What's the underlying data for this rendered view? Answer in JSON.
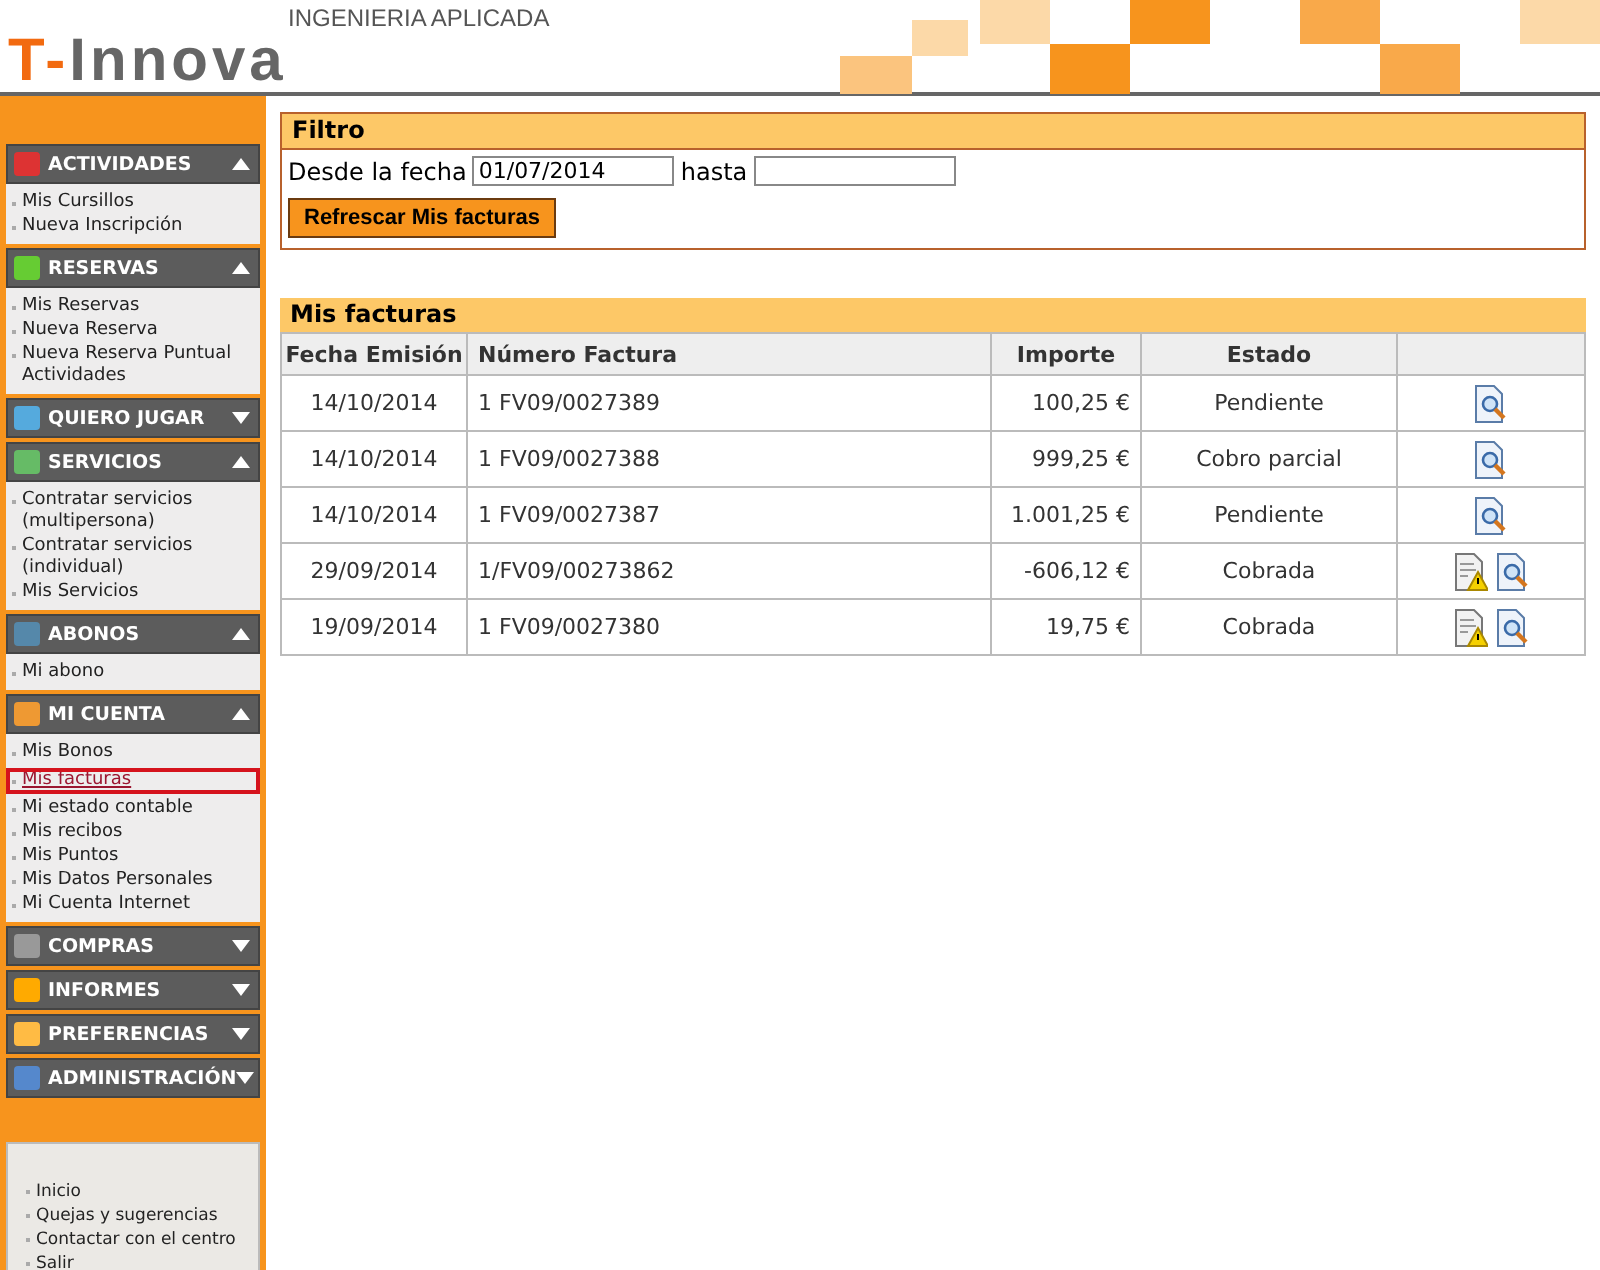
{
  "header": {
    "logo_prefix": "T-",
    "logo_name": "Innova",
    "tagline": "INGENIERIA APLICADA"
  },
  "sidebar": {
    "sections": [
      {
        "title": "ACTIVIDADES",
        "expanded": true,
        "items": [
          {
            "label": "Mis Cursillos",
            "selected": false
          },
          {
            "label": "Nueva Inscripción",
            "selected": false
          }
        ]
      },
      {
        "title": "RESERVAS",
        "expanded": true,
        "items": [
          {
            "label": "Mis Reservas",
            "selected": false
          },
          {
            "label": "Nueva Reserva",
            "selected": false
          },
          {
            "label": "Nueva Reserva Puntual Actividades",
            "selected": false
          }
        ]
      },
      {
        "title": "QUIERO JUGAR",
        "expanded": false
      },
      {
        "title": "SERVICIOS",
        "expanded": true,
        "items": [
          {
            "label": "Contratar servicios (multipersona)",
            "selected": false
          },
          {
            "label": "Contratar servicios (individual)",
            "selected": false
          },
          {
            "label": "Mis Servicios",
            "selected": false
          }
        ]
      },
      {
        "title": "ABONOS",
        "expanded": true,
        "items": [
          {
            "label": "Mi abono",
            "selected": false
          }
        ]
      },
      {
        "title": "MI CUENTA",
        "expanded": true,
        "items": [
          {
            "label": "Mis Bonos",
            "selected": false
          },
          {
            "label": "Mis facturas",
            "selected": true
          },
          {
            "label": "Mi estado contable",
            "selected": false
          },
          {
            "label": "Mis recibos",
            "selected": false
          },
          {
            "label": "Mis Puntos",
            "selected": false
          },
          {
            "label": "Mis Datos Personales",
            "selected": false
          },
          {
            "label": "Mi Cuenta Internet",
            "selected": false
          }
        ]
      },
      {
        "title": "COMPRAS",
        "expanded": false
      },
      {
        "title": "INFORMES",
        "expanded": false
      },
      {
        "title": "PREFERENCIAS",
        "expanded": false
      },
      {
        "title": "ADMINISTRACIÓN",
        "expanded": false
      }
    ],
    "footer_links": [
      "Inicio",
      "Quejas y sugerencias",
      "Contactar con el centro",
      "Salir"
    ]
  },
  "filter": {
    "title": "Filtro",
    "from_label": "Desde la fecha",
    "from_value": "01/07/2014",
    "to_label": "hasta",
    "button": "Refrescar Mis facturas"
  },
  "invoices": {
    "title": "Mis facturas",
    "columns": [
      "Fecha Emisión",
      "Número Factura",
      "Importe",
      "Estado"
    ],
    "rows": [
      {
        "date": "14/10/2014",
        "number": "1 FV09/0027389",
        "amount": "100,25 €",
        "status": "Pendiente",
        "actions": [
          {
            "kind": "view"
          }
        ]
      },
      {
        "date": "14/10/2014",
        "number": "1 FV09/0027388",
        "amount": "999,25 €",
        "status": "Cobro parcial",
        "actions": [
          {
            "kind": "view"
          }
        ]
      },
      {
        "date": "14/10/2014",
        "number": "1 FV09/0027387",
        "amount": "1.001,25 €",
        "status": "Pendiente",
        "actions": [
          {
            "kind": "view"
          }
        ]
      },
      {
        "date": "29/09/2014",
        "number": "1/FV09/00273862",
        "amount": "-606,12 €",
        "status": "Cobrada",
        "actions": [
          {
            "kind": "warning"
          },
          {
            "kind": "view"
          }
        ]
      },
      {
        "date": "19/09/2014",
        "number": "1 FV09/0027380",
        "amount": "19,75 €",
        "status": "Cobrada",
        "actions": [
          {
            "kind": "warning"
          },
          {
            "kind": "view"
          }
        ]
      }
    ]
  }
}
